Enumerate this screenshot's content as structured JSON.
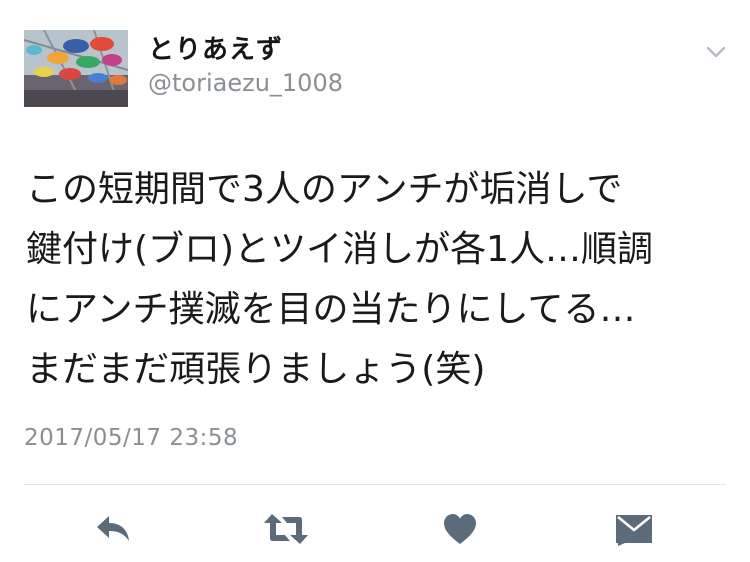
{
  "user": {
    "display_name": "とりあえず",
    "handle": "@toriaezu_1008",
    "avatar_icon": "umbrella-photo-avatar"
  },
  "tweet": {
    "lines": [
      "この短期間で3人のアンチが垢消しで",
      "鍵付け(ブロ)とツイ消しが各1人…順調",
      "にアンチ撲滅を目の当たりにしてる…",
      "まだまだ頑張りましょう(笑)"
    ],
    "timestamp": "2017/05/17 23:58"
  },
  "actions": {
    "reply_icon": "reply-icon",
    "retweet_icon": "retweet-icon",
    "like_icon": "heart-icon",
    "dm_icon": "envelope-icon"
  },
  "colors": {
    "text": "#14171a",
    "secondary": "#8a8f94",
    "icon": "#5b6b7a",
    "divider": "#e1e8ed"
  }
}
